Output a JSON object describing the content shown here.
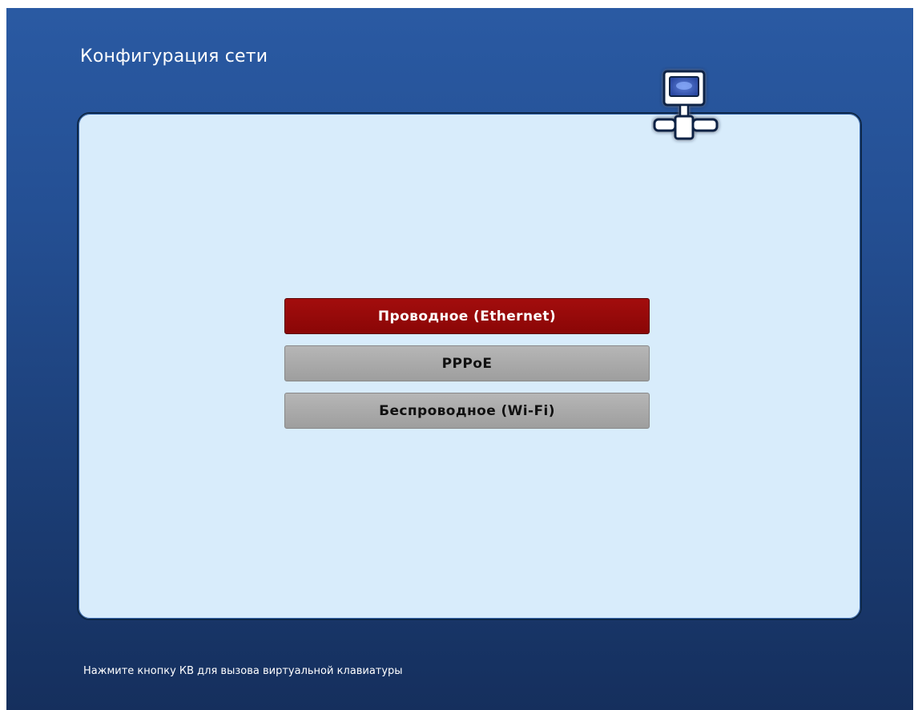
{
  "header": {
    "title": "Конфигурация сети"
  },
  "icon": "network-computer-icon",
  "menu": {
    "items": [
      {
        "label": "Проводное (Ethernet)",
        "selected": true
      },
      {
        "label": "PPPoE",
        "selected": false
      },
      {
        "label": "Беспроводное (Wi-Fi)",
        "selected": false
      }
    ]
  },
  "footer": {
    "hint": "Нажмите кнопку КВ для вызова виртуальной клавиатуры"
  },
  "colors": {
    "background": "#244f93",
    "panel": "#d8ecfb",
    "selected_item": "#8a0606",
    "normal_item": "#a8a8a8"
  }
}
